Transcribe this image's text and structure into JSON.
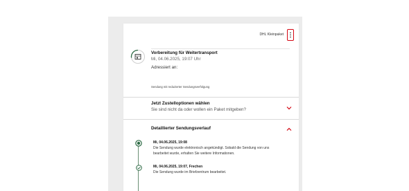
{
  "header": {
    "product_label": "DHL Kleinpaket",
    "menu_icon": "kebab-menu-icon"
  },
  "status": {
    "icon": "package-status-icon",
    "title": "Vorbereitung für Weitertransport",
    "date": "Mi, 04.06.2025, 19:07 Uhr",
    "addressed_label": "Adressiert an:",
    "reduced_note": "Sendung mit reduzierter Sendungsverfolgung"
  },
  "delivery_options": {
    "title": "Jetzt Zustelloptionen wählen",
    "subtitle": "Sie sind nicht da oder wollen ein Paket mitgeben?",
    "icon": "chevron-down-icon"
  },
  "history": {
    "title": "Detaillierter Sendungsverlauf",
    "icon": "chevron-up-icon",
    "events": [
      {
        "time": "Mi, 04.06.2025, 19:08",
        "text_line1": "Die Sendung wurde elektronisch angekündigt. Sobald die Sendung von uns",
        "text_line2": "bearbeitet wurde, erhalten Sie weitere Informationen."
      },
      {
        "time": "Mi, 04.06.2025, 19:07, Frechen",
        "text_line1": "Die Sendung wurde im Briefzentrum bearbeitet."
      }
    ]
  },
  "colors": {
    "accent_red": "#d40511",
    "timeline_green": "#2e6b45",
    "backdrop": "#ececec"
  }
}
